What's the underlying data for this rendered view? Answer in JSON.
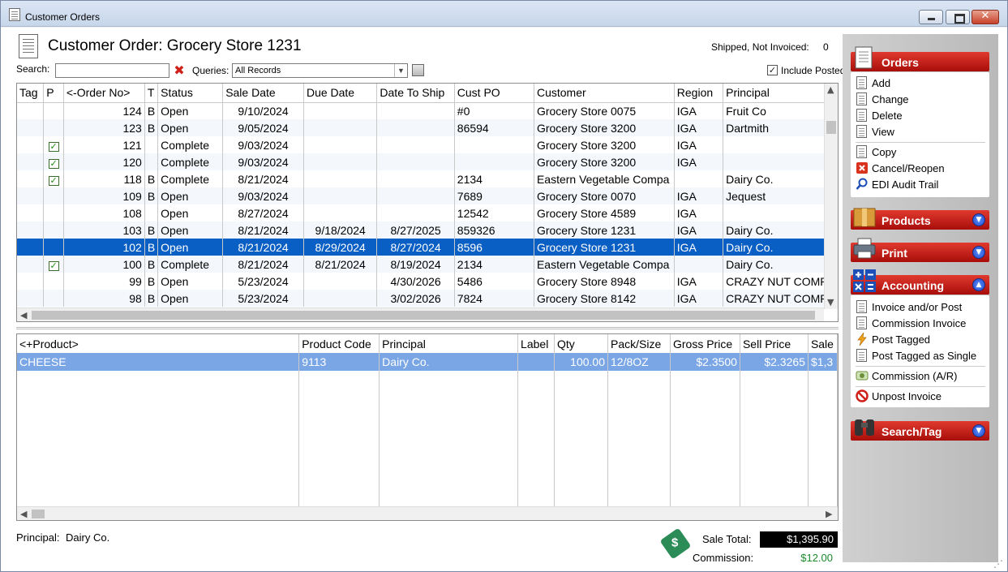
{
  "window": {
    "title": "Customer Orders"
  },
  "header": {
    "title": "Customer Order: Grocery Store 1231",
    "shipped_not_invoiced_label": "Shipped, Not Invoiced:",
    "shipped_not_invoiced_count": "0"
  },
  "search": {
    "label": "Search:",
    "value": "",
    "placeholder": ""
  },
  "queries": {
    "label": "Queries:",
    "selected": "All Records"
  },
  "include_posted": {
    "label": "Include Posted",
    "checked": true
  },
  "orders_grid": {
    "columns": [
      "Tag",
      "P",
      "<-Order No>",
      "T",
      "Status",
      "Sale Date",
      "Due Date",
      "Date To Ship",
      "Cust PO",
      "Customer",
      "Region",
      "Principal"
    ],
    "rows": [
      {
        "tag": "",
        "p": false,
        "order_no": "124",
        "t": "B",
        "status": "Open",
        "sale_date": "9/10/2024",
        "due_date": "",
        "date_to_ship": "",
        "cust_po": "#0",
        "customer": "Grocery Store 0075",
        "region": "IGA",
        "principal": "Fruit Co"
      },
      {
        "tag": "",
        "p": false,
        "order_no": "123",
        "t": "B",
        "status": "Open",
        "sale_date": "9/05/2024",
        "due_date": "",
        "date_to_ship": "",
        "cust_po": "86594",
        "customer": "Grocery Store 3200",
        "region": "IGA",
        "principal": "Dartmith"
      },
      {
        "tag": "",
        "p": true,
        "order_no": "121",
        "t": "",
        "status": "Complete",
        "sale_date": "9/03/2024",
        "due_date": "",
        "date_to_ship": "",
        "cust_po": "",
        "customer": "Grocery Store 3200",
        "region": "IGA",
        "principal": ""
      },
      {
        "tag": "",
        "p": true,
        "order_no": "120",
        "t": "",
        "status": "Complete",
        "sale_date": "9/03/2024",
        "due_date": "",
        "date_to_ship": "",
        "cust_po": "",
        "customer": "Grocery Store 3200",
        "region": "IGA",
        "principal": ""
      },
      {
        "tag": "",
        "p": true,
        "order_no": "118",
        "t": "B",
        "status": "Complete",
        "sale_date": "8/21/2024",
        "due_date": "",
        "date_to_ship": "",
        "cust_po": "2134",
        "customer": "Eastern Vegetable Compa",
        "region": "",
        "principal": "Dairy Co."
      },
      {
        "tag": "",
        "p": false,
        "order_no": "109",
        "t": "B",
        "status": "Open",
        "sale_date": "9/03/2024",
        "due_date": "",
        "date_to_ship": "",
        "cust_po": "7689",
        "customer": "Grocery Store 0070",
        "region": "IGA",
        "principal": "Jequest"
      },
      {
        "tag": "",
        "p": false,
        "order_no": "108",
        "t": "",
        "status": "Open",
        "sale_date": "8/27/2024",
        "due_date": "",
        "date_to_ship": "",
        "cust_po": "12542",
        "customer": "Grocery Store 4589",
        "region": "IGA",
        "principal": ""
      },
      {
        "tag": "",
        "p": false,
        "order_no": "103",
        "t": "B",
        "status": "Open",
        "sale_date": "8/21/2024",
        "due_date": "9/18/2024",
        "date_to_ship": "8/27/2025",
        "cust_po": "859326",
        "customer": "Grocery Store 1231",
        "region": "IGA",
        "principal": "Dairy Co."
      },
      {
        "tag": "",
        "p": false,
        "order_no": "102",
        "t": "B",
        "status": "Open",
        "sale_date": "8/21/2024",
        "due_date": "8/29/2024",
        "date_to_ship": "8/27/2024",
        "cust_po": "8596",
        "customer": "Grocery Store 1231",
        "region": "IGA",
        "principal": "Dairy Co.",
        "selected": true
      },
      {
        "tag": "",
        "p": true,
        "order_no": "100",
        "t": "B",
        "status": "Complete",
        "sale_date": "8/21/2024",
        "due_date": "8/21/2024",
        "date_to_ship": "8/19/2024",
        "cust_po": "2134",
        "customer": "Eastern Vegetable Compa",
        "region": "",
        "principal": "Dairy Co."
      },
      {
        "tag": "",
        "p": false,
        "order_no": "99",
        "t": "B",
        "status": "Open",
        "sale_date": "5/23/2024",
        "due_date": "",
        "date_to_ship": "4/30/2026",
        "cust_po": "5486",
        "customer": "Grocery Store 8948",
        "region": "IGA",
        "principal": "CRAZY NUT COMPA"
      },
      {
        "tag": "",
        "p": false,
        "order_no": "98",
        "t": "B",
        "status": "Open",
        "sale_date": "5/23/2024",
        "due_date": "",
        "date_to_ship": "3/02/2026",
        "cust_po": "7824",
        "customer": "Grocery Store 8142",
        "region": "IGA",
        "principal": "CRAZY NUT COMPA"
      }
    ]
  },
  "lines_grid": {
    "columns": [
      "<+Product>",
      "Product Code",
      "Principal",
      "Label",
      "Qty",
      "Pack/Size",
      "Gross Price",
      "Sell Price",
      "Sale"
    ],
    "rows": [
      {
        "product": "CHEESE",
        "code": "9113",
        "principal": "Dairy Co.",
        "label": "",
        "qty": "100.00",
        "pack": "12/8OZ",
        "gross": "$2.3500",
        "sell": "$2.3265",
        "sale": "$1,3"
      }
    ]
  },
  "footer": {
    "principal_label": "Principal:",
    "principal_value": "Dairy Co.",
    "sale_total_label": "Sale Total:",
    "sale_total_value": "$1,395.90",
    "commission_label": "Commission:",
    "commission_value": "$12.00"
  },
  "sidebar": {
    "orders": {
      "title": "Orders",
      "items": [
        {
          "label": "Add",
          "icon": "add-doc-icon"
        },
        {
          "label": "Change",
          "icon": "edit-doc-icon"
        },
        {
          "label": "Delete",
          "icon": "delete-doc-icon"
        },
        {
          "label": "View",
          "icon": "view-doc-icon"
        },
        {
          "label": "Copy",
          "icon": "copy-icon"
        },
        {
          "label": "Cancel/Reopen",
          "icon": "cancel-icon"
        },
        {
          "label": "EDI Audit Trail",
          "icon": "magnifier-icon"
        }
      ]
    },
    "products": {
      "title": "Products"
    },
    "print": {
      "title": "Print"
    },
    "accounting": {
      "title": "Accounting",
      "items": [
        {
          "label": "Invoice and/or Post",
          "icon": "invoice-icon"
        },
        {
          "label": "Commission Invoice",
          "icon": "commission-invoice-icon"
        },
        {
          "label": "Post Tagged",
          "icon": "lightning-icon"
        },
        {
          "label": "Post Tagged as Single",
          "icon": "post-single-icon"
        },
        {
          "label": "Commission (A/R)",
          "icon": "commission-ar-icon"
        },
        {
          "label": "Unpost Invoice",
          "icon": "unpost-icon"
        }
      ]
    },
    "search_tag": {
      "title": "Search/Tag"
    }
  },
  "colors": {
    "selection": "#0a5fc4",
    "panel_red": "#c0150f",
    "commission_green": "#1a8a2a"
  }
}
